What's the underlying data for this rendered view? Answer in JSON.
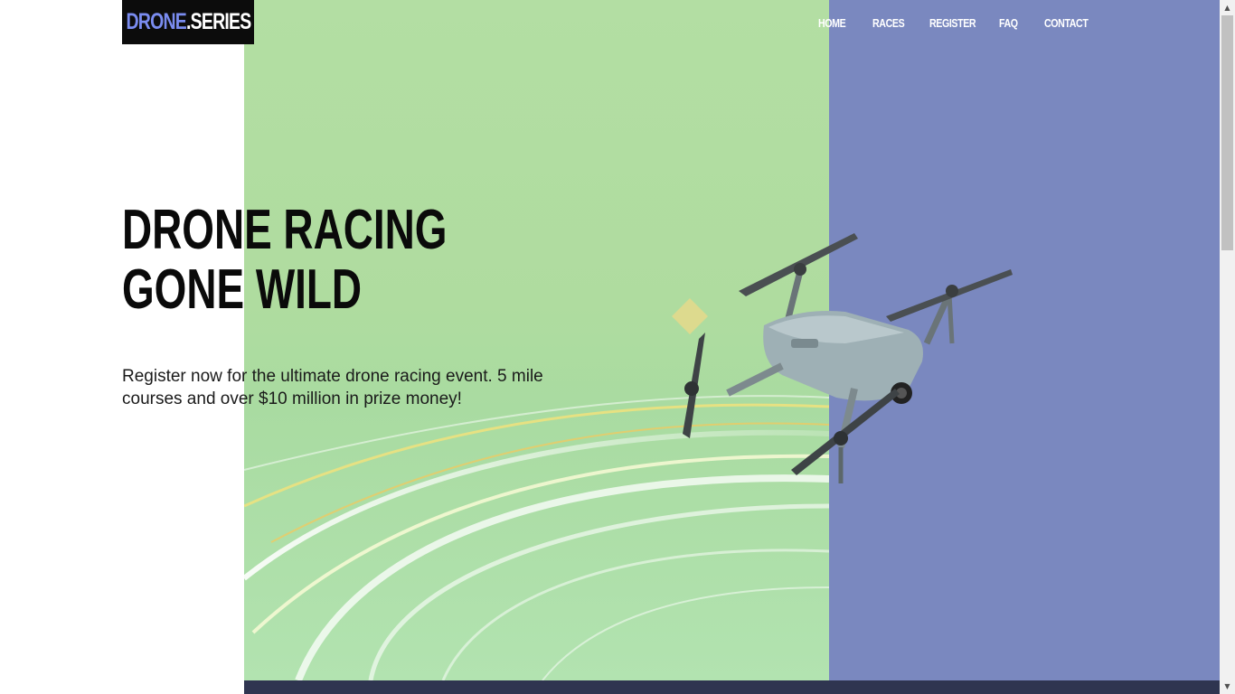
{
  "header": {
    "logo": {
      "part_a": "DRONE",
      "part_b": ".SERIES"
    },
    "nav": [
      "HOME",
      "RACES",
      "REGISTER",
      "FAQ",
      "CONTACT"
    ]
  },
  "hero": {
    "headline": "DRONE RACING GONE WILD",
    "subtext": "Register now for the ultimate drone racing event. 5 mile courses and over $10 million in prize money!",
    "image": "drone-photo"
  },
  "colors": {
    "accent_blue": "#7a88bf",
    "accent_green": "#b3dea3",
    "logo_accent": "#7a8cf0",
    "logo_bg": "#0c0c0c"
  },
  "scrollbar": {
    "up_icon": "chevron-up-icon",
    "down_icon": "chevron-down-icon"
  }
}
